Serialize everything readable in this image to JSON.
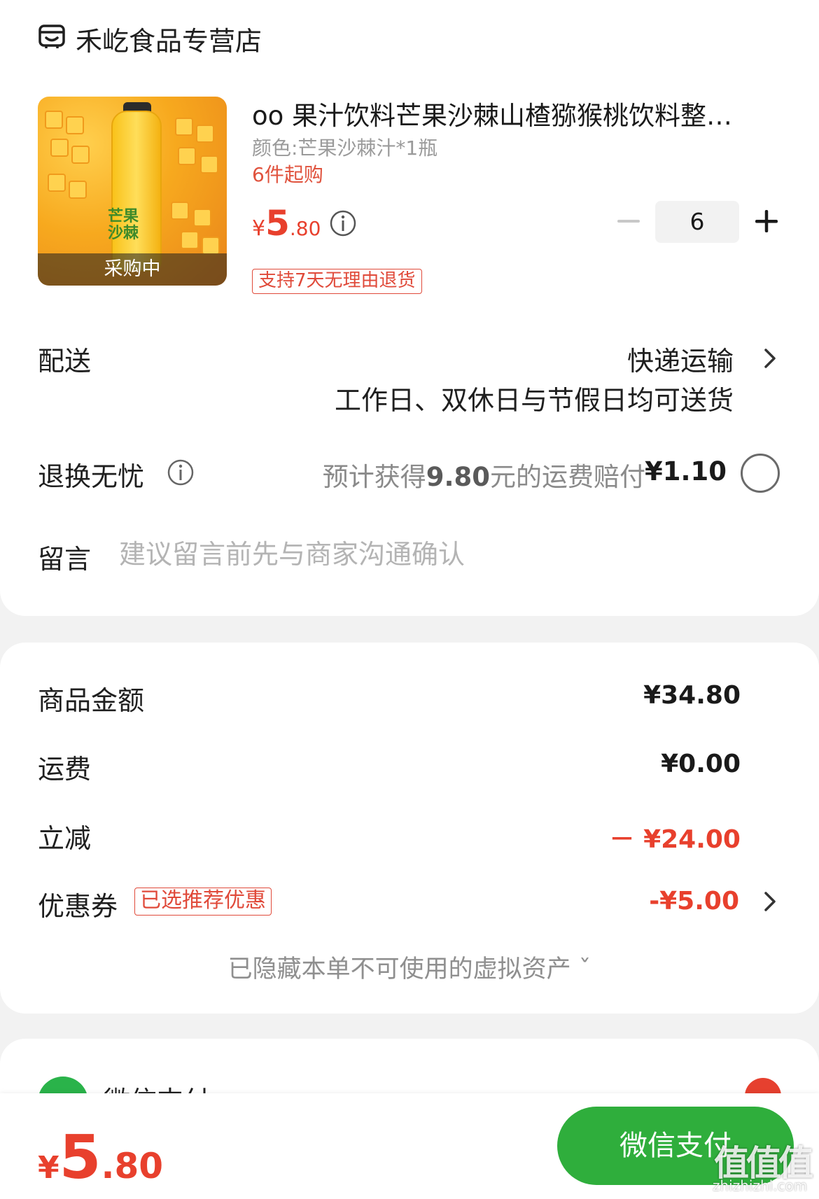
{
  "store": {
    "name": "禾屹食品专营店",
    "icon": "store-icon"
  },
  "product": {
    "title": "oo 果汁饮料芒果沙棘山楂猕猴桃饮料整…",
    "spec": "颜色:芒果沙棘汁*1瓶",
    "min_purchase": "6件起购",
    "image_label": "芒果沙棘",
    "image_badge": "采购中",
    "price_currency": "¥",
    "price_integer": "5",
    "price_decimal": ".80",
    "quantity": "6",
    "return_policy": "支持7天无理由退货"
  },
  "delivery": {
    "label": "配送",
    "method": "快递运输",
    "note": "工作日、双休日与节假日均可送货"
  },
  "worry_free": {
    "label": "退换无忧",
    "desc_prefix": "预计获得",
    "desc_amount": "9.80",
    "desc_suffix": "元的运费赔付",
    "price": "¥1.10",
    "selected": false
  },
  "message": {
    "label": "留言",
    "placeholder": "建议留言前先与商家沟通确认"
  },
  "summary": {
    "goods_label": "商品金额",
    "goods_value": "¥34.80",
    "shipping_label": "运费",
    "shipping_value": "¥0.00",
    "discount_label": "立减",
    "discount_value": "－ ¥24.00",
    "coupon_label": "优惠券",
    "coupon_tag": "已选推荐优惠",
    "coupon_value": "-¥5.00",
    "hidden_assets": "已隐藏本单不可使用的虚拟资产 ˇ"
  },
  "payment": {
    "method_label": "微信支付"
  },
  "bottom_bar": {
    "total_currency": "¥",
    "total_integer": "5",
    "total_decimal": ".80",
    "pay_button": "微信支付",
    "watermark_logo": "值值值",
    "watermark_url": "zhizhizhi.com"
  },
  "colors": {
    "accent_red": "#e8402d",
    "wechat_green": "#2fae3c"
  }
}
